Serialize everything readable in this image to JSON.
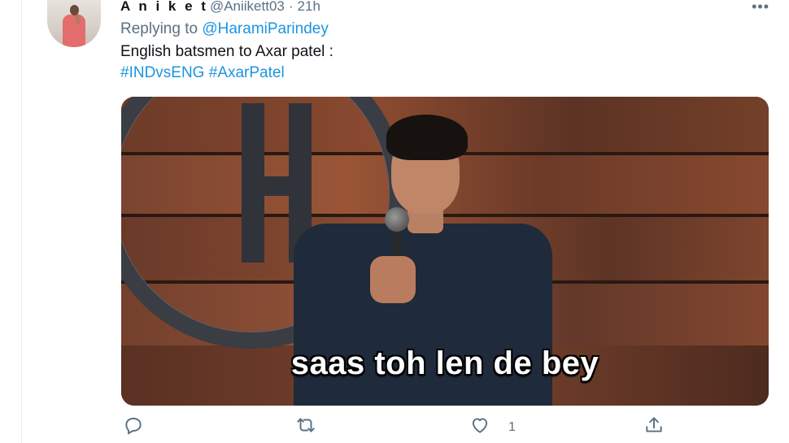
{
  "tweet": {
    "author_name": "A n i k e t",
    "handle": "@Aniikett03",
    "separator": "·",
    "timestamp": "21h",
    "more_label": "•••",
    "reply_prefix": "Replying to",
    "reply_to": "@HaramiParindey",
    "text": "English batsmen to Axar patel :",
    "hashtags": [
      "#INDvsENG",
      "#AxarPatel"
    ],
    "media_caption": "saas toh len de bey"
  },
  "actions": {
    "reply_icon": "reply-icon",
    "retweet_icon": "retweet-icon",
    "like_icon": "like-icon",
    "like_count": "1",
    "share_icon": "share-icon"
  },
  "colors": {
    "link": "#1b95e0",
    "secondary_text": "#5b7083",
    "icon": "#5b7083"
  }
}
